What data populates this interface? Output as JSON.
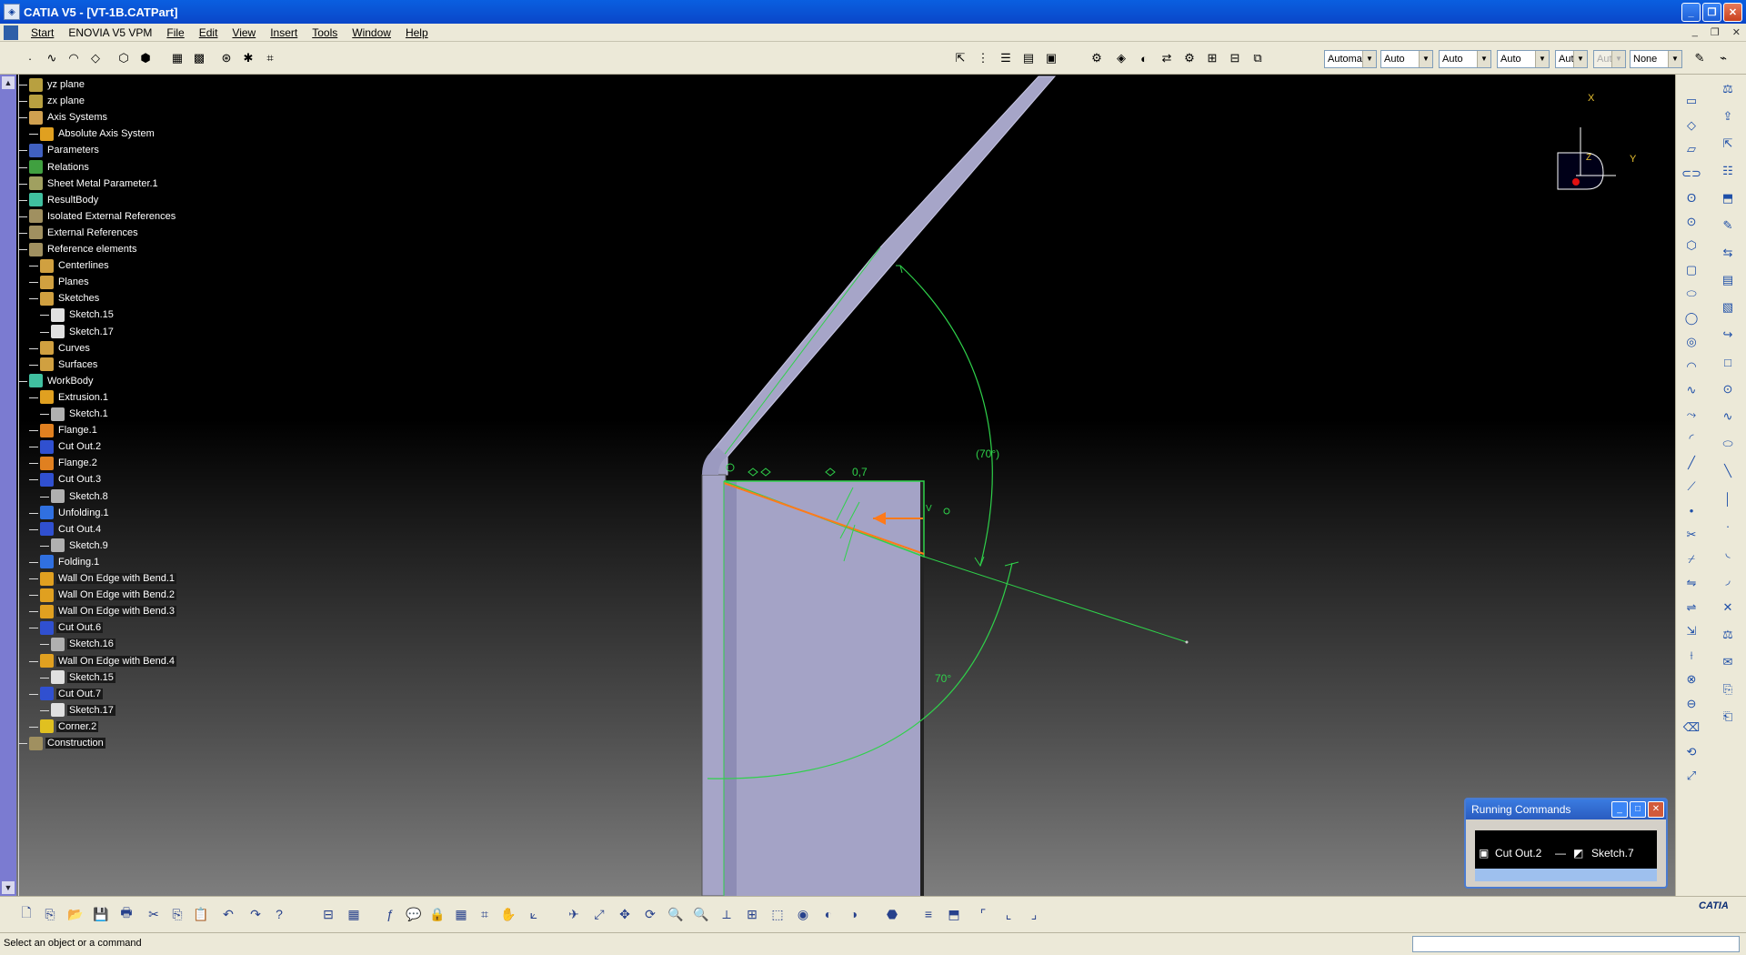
{
  "window": {
    "title": "CATIA V5 - [VT-1B.CATPart]",
    "min": "_",
    "restore": "❐",
    "close": "✕"
  },
  "menu": [
    {
      "label": "Start",
      "underline": true
    },
    {
      "label": "ENOVIA V5 VPM",
      "underline": false
    },
    {
      "label": "File",
      "underline": true
    },
    {
      "label": "Edit",
      "underline": true
    },
    {
      "label": "View",
      "underline": true
    },
    {
      "label": "Insert",
      "underline": true
    },
    {
      "label": "Tools",
      "underline": true
    },
    {
      "label": "Window",
      "underline": true
    },
    {
      "label": "Help",
      "underline": true
    }
  ],
  "graphic_props": {
    "combos": [
      "Automa",
      "Auto",
      "Auto",
      "Auto",
      "Aut",
      "Aut",
      "None"
    ]
  },
  "tree": [
    {
      "label": "yz plane",
      "level": 1,
      "icon": "plane-icon",
      "color": "#b8a040",
      "hl": false
    },
    {
      "label": "zx plane",
      "level": 1,
      "icon": "plane-icon",
      "color": "#b8a040",
      "hl": false
    },
    {
      "label": "Axis Systems",
      "level": 1,
      "icon": "axis-systems-icon",
      "color": "#d0a050",
      "hl": false
    },
    {
      "label": "Absolute Axis System",
      "level": 2,
      "icon": "axis-system-icon",
      "color": "#e0a020",
      "hl": false
    },
    {
      "label": "Parameters",
      "level": 1,
      "icon": "parameters-icon",
      "color": "#4060c0",
      "hl": false
    },
    {
      "label": "Relations",
      "level": 1,
      "icon": "relations-icon",
      "color": "#40a040",
      "hl": false
    },
    {
      "label": "Sheet Metal Parameter.1",
      "level": 1,
      "icon": "sheet-metal-parameter-icon",
      "color": "#a0a060",
      "hl": false
    },
    {
      "label": "ResultBody",
      "level": 1,
      "icon": "body-icon",
      "color": "#40c0a0",
      "hl": false
    },
    {
      "label": "Isolated External References",
      "level": 1,
      "icon": "external-references-icon",
      "color": "#a09060",
      "hl": false
    },
    {
      "label": "External References",
      "level": 1,
      "icon": "external-references-icon",
      "color": "#a09060",
      "hl": false
    },
    {
      "label": "Reference elements",
      "level": 1,
      "icon": "reference-elements-icon",
      "color": "#a09060",
      "hl": false
    },
    {
      "label": "Centerlines",
      "level": 2,
      "icon": "folder-icon",
      "color": "#d0a040",
      "hl": false
    },
    {
      "label": "Planes",
      "level": 2,
      "icon": "folder-icon",
      "color": "#d0a040",
      "hl": false
    },
    {
      "label": "Sketches",
      "level": 2,
      "icon": "folder-icon",
      "color": "#d0a040",
      "hl": false
    },
    {
      "label": "Sketch.15",
      "level": 3,
      "icon": "sketch-icon",
      "color": "#e0e0e0",
      "hl": false
    },
    {
      "label": "Sketch.17",
      "level": 3,
      "icon": "sketch-icon",
      "color": "#e0e0e0",
      "hl": false
    },
    {
      "label": "Curves",
      "level": 2,
      "icon": "folder-icon",
      "color": "#d0a040",
      "hl": false
    },
    {
      "label": "Surfaces",
      "level": 2,
      "icon": "folder-icon",
      "color": "#d0a040",
      "hl": false
    },
    {
      "label": "WorkBody",
      "level": 1,
      "icon": "body-icon",
      "color": "#40c0a0",
      "hl": false
    },
    {
      "label": "Extrusion.1",
      "level": 2,
      "icon": "extrusion-icon",
      "color": "#e0a020",
      "hl": false
    },
    {
      "label": "Sketch.1",
      "level": 3,
      "icon": "sketch-icon",
      "color": "#b0b0b0",
      "hl": false
    },
    {
      "label": "Flange.1",
      "level": 2,
      "icon": "flange-icon",
      "color": "#e08020",
      "hl": false
    },
    {
      "label": "Cut Out.2",
      "level": 2,
      "icon": "cutout-icon",
      "color": "#3050d0",
      "hl": false
    },
    {
      "label": "Flange.2",
      "level": 2,
      "icon": "flange-icon",
      "color": "#e08020",
      "hl": false
    },
    {
      "label": "Cut Out.3",
      "level": 2,
      "icon": "cutout-icon",
      "color": "#3050d0",
      "hl": false
    },
    {
      "label": "Sketch.8",
      "level": 3,
      "icon": "sketch-icon",
      "color": "#b0b0b0",
      "hl": false
    },
    {
      "label": "Unfolding.1",
      "level": 2,
      "icon": "unfolding-icon",
      "color": "#3070e0",
      "hl": false
    },
    {
      "label": "Cut Out.4",
      "level": 2,
      "icon": "cutout-icon",
      "color": "#3050d0",
      "hl": false
    },
    {
      "label": "Sketch.9",
      "level": 3,
      "icon": "sketch-icon",
      "color": "#b0b0b0",
      "hl": false
    },
    {
      "label": "Folding.1",
      "level": 2,
      "icon": "folding-icon",
      "color": "#3070e0",
      "hl": false
    },
    {
      "label": "Wall On Edge with Bend.1",
      "level": 2,
      "icon": "wall-on-edge-icon",
      "color": "#e0a020",
      "hl": true
    },
    {
      "label": "Wall On Edge with Bend.2",
      "level": 2,
      "icon": "wall-on-edge-icon",
      "color": "#e0a020",
      "hl": true
    },
    {
      "label": "Wall On Edge with Bend.3",
      "level": 2,
      "icon": "wall-on-edge-icon",
      "color": "#e0a020",
      "hl": true
    },
    {
      "label": "Cut Out.6",
      "level": 2,
      "icon": "cutout-icon",
      "color": "#3050d0",
      "hl": true
    },
    {
      "label": "Sketch.16",
      "level": 3,
      "icon": "sketch-icon",
      "color": "#b0b0b0",
      "hl": true
    },
    {
      "label": "Wall On Edge with Bend.4",
      "level": 2,
      "icon": "wall-on-edge-icon",
      "color": "#e0a020",
      "hl": true
    },
    {
      "label": "Sketch.15",
      "level": 3,
      "icon": "sketch-icon",
      "color": "#e0e0e0",
      "hl": true
    },
    {
      "label": "Cut Out.7",
      "level": 2,
      "icon": "cutout-icon",
      "color": "#3050d0",
      "hl": true
    },
    {
      "label": "Sketch.17",
      "level": 3,
      "icon": "sketch-icon",
      "color": "#e0e0e0",
      "hl": true
    },
    {
      "label": "Corner.2",
      "level": 2,
      "icon": "corner-icon",
      "color": "#e0c020",
      "hl": true
    },
    {
      "label": "Construction",
      "level": 1,
      "icon": "construction-icon",
      "color": "#a09060",
      "hl": true
    }
  ],
  "scene": {
    "dim_thickness": "0,7",
    "angle_ref": "(70°)",
    "angle": "70°",
    "v_label": "V"
  },
  "compass": {
    "x": "X",
    "y": "Y",
    "z": "Z"
  },
  "running_commands": {
    "title": "Running Commands",
    "items": [
      "Cut Out.2",
      "Sketch.7"
    ]
  },
  "status": {
    "message": "Select an object or a command"
  },
  "logo": "CATIA"
}
